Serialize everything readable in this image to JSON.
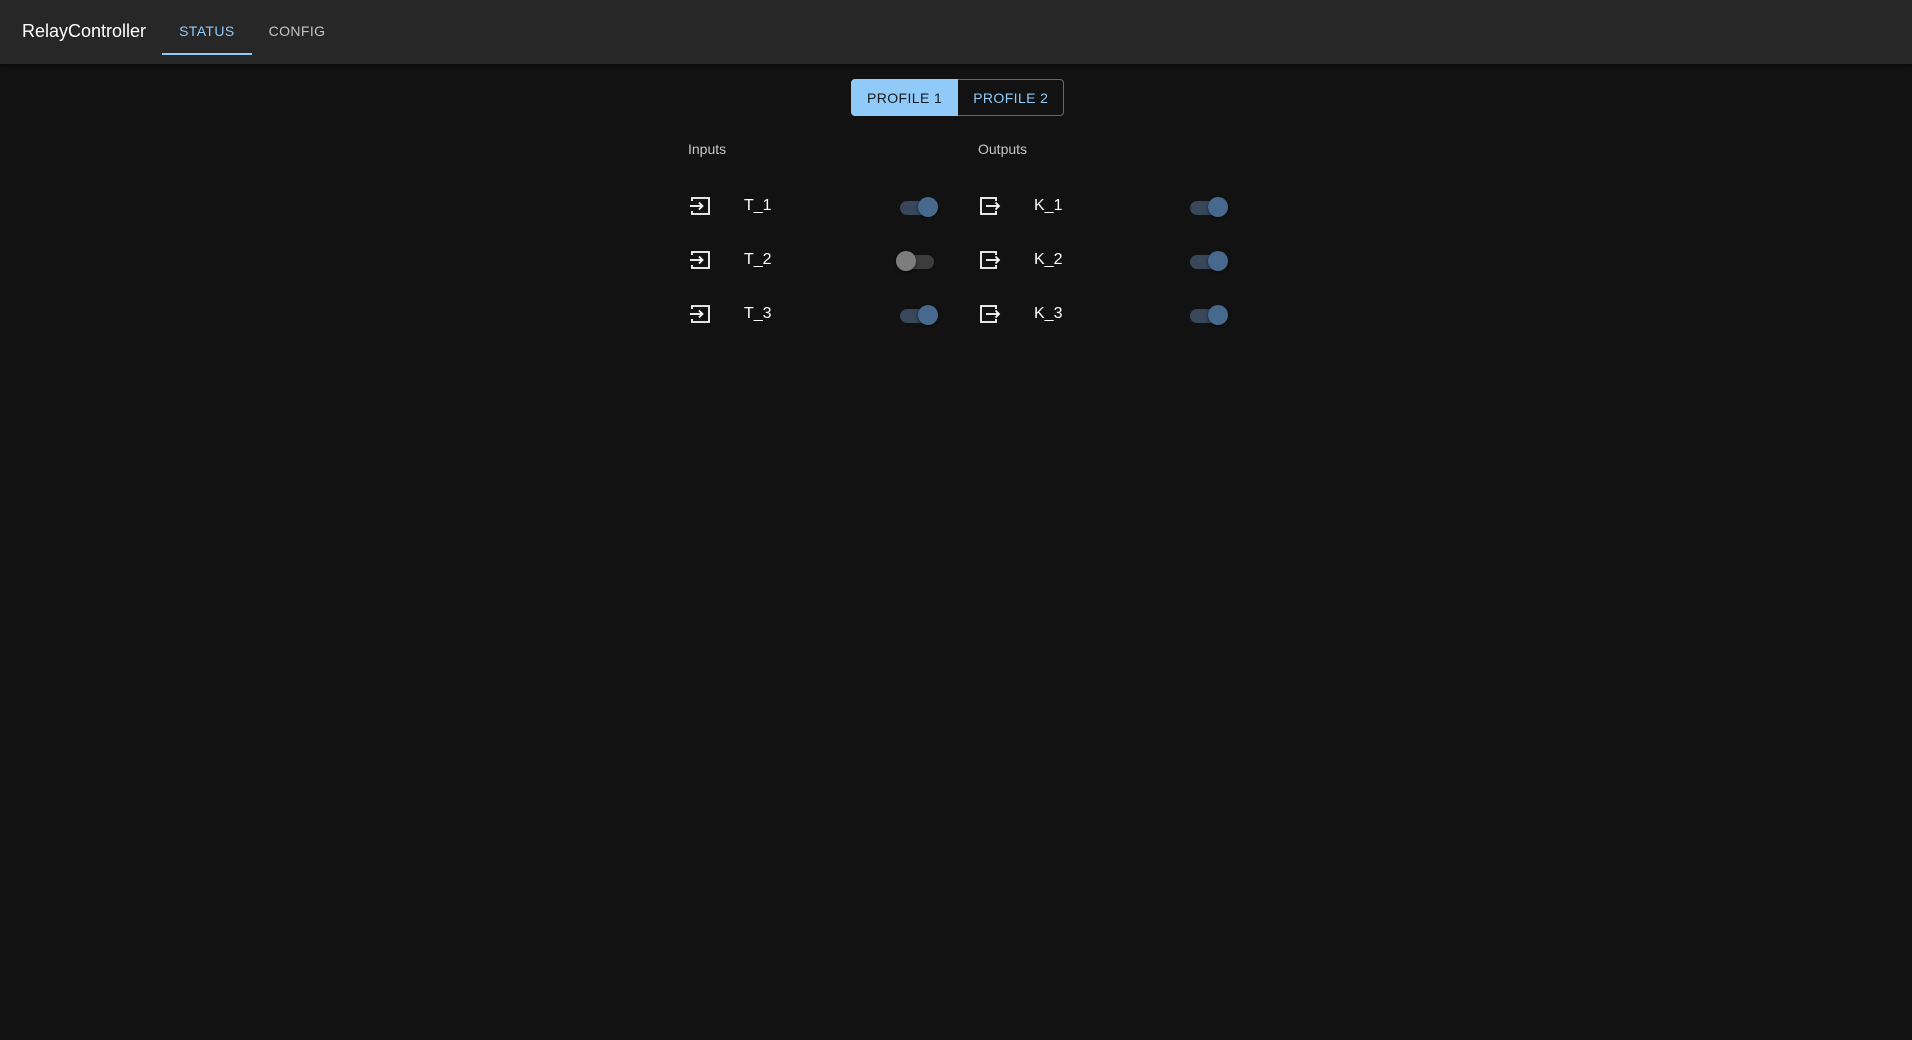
{
  "app": {
    "title": "RelayController",
    "tabs": [
      {
        "label": "STATUS",
        "active": true
      },
      {
        "label": "CONFIG",
        "active": false
      }
    ]
  },
  "profiles": {
    "options": [
      "PROFILE 1",
      "PROFILE 2"
    ],
    "selected": "PROFILE 1"
  },
  "inputs": {
    "title": "Inputs",
    "items": [
      {
        "label": "T_1",
        "icon": "login-icon",
        "on": true
      },
      {
        "label": "T_2",
        "icon": "login-icon",
        "on": false
      },
      {
        "label": "T_3",
        "icon": "login-icon",
        "on": true
      }
    ]
  },
  "outputs": {
    "title": "Outputs",
    "items": [
      {
        "label": "K_1",
        "icon": "logout-icon",
        "on": true
      },
      {
        "label": "K_2",
        "icon": "logout-icon",
        "on": true
      },
      {
        "label": "K_3",
        "icon": "logout-icon",
        "on": true
      }
    ]
  },
  "colors": {
    "accent": "#90caf9",
    "background": "#121212",
    "appbar": "#272727",
    "switch_on": "#46698d",
    "switch_off": "#7d7d7d"
  }
}
